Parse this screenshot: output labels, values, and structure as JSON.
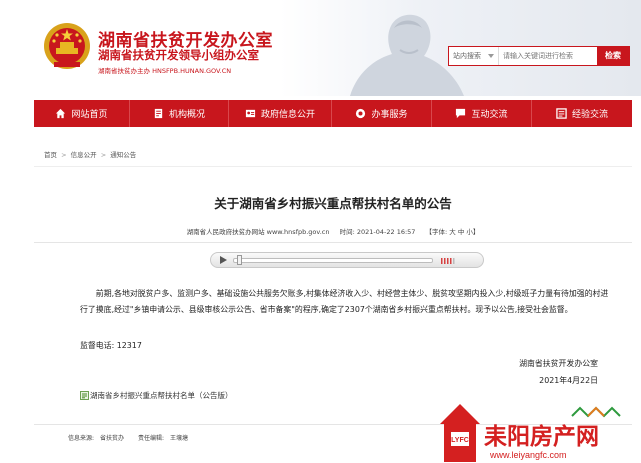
{
  "header": {
    "org_title": "湖南省扶贫开发办公室",
    "org_subtitle": "湖南省扶贫开发领导小组办公室",
    "org_url": "湖南省扶贫办主办 HNSFPB.HUNAN.GOV.CN",
    "top_fragment": "…"
  },
  "search": {
    "scope_label": "站内搜索",
    "placeholder": "请输入关键词进行检索",
    "button_label": "检索"
  },
  "nav": {
    "items": [
      {
        "label": "网站首页",
        "icon": "home-icon"
      },
      {
        "label": "机构概况",
        "icon": "document-icon"
      },
      {
        "label": "政府信息公开",
        "icon": "id-card-icon"
      },
      {
        "label": "办事服务",
        "icon": "globe-icon"
      },
      {
        "label": "互动交流",
        "icon": "chat-icon"
      },
      {
        "label": "经验交流",
        "icon": "notes-icon"
      }
    ]
  },
  "breadcrumb": {
    "items": [
      "首页",
      "信息公开",
      "通知公告"
    ],
    "separator": ">"
  },
  "article": {
    "title": "关于湖南省乡村振兴重点帮扶村名单的公告",
    "meta_source": "湖南省人民政府扶贫办网站 www.hnsfpb.gov.cn",
    "meta_time_label": "时间:",
    "meta_time": "2021-04-22 16:57",
    "meta_font": "【字体: 大 中 小】",
    "body": "前期,各地对脱贫户多、监测户多、基础设施公共服务欠账多,村集体经济收入少、村经营主体少、脱贫攻坚期内投入少,村级班子力量有待加强的村进行了摸底,经过\"乡镇申请公示、县级审核公示公告、省市备案\"的程序,确定了2307个湖南省乡村振兴重点帮扶村。现予以公告,接受社会监督。",
    "phone_label": "监督电话:",
    "phone": "12317",
    "sign_org": "湖南省扶贫开发办公室",
    "sign_date": "2021年4月22日",
    "attachment": "湖南省乡村振兴重点帮扶村名单（公告版）"
  },
  "footer": {
    "source_label": "信息来源:",
    "source": "省扶贫办",
    "editor_label": "责任编辑:",
    "editor": "王壤塘"
  },
  "watermark": {
    "badge": "LYFC",
    "brand": "耒阳房产网",
    "url": "www.leiyangfc.com"
  },
  "colors": {
    "brand_red": "#c8161d",
    "watermark_red": "#d42020"
  }
}
